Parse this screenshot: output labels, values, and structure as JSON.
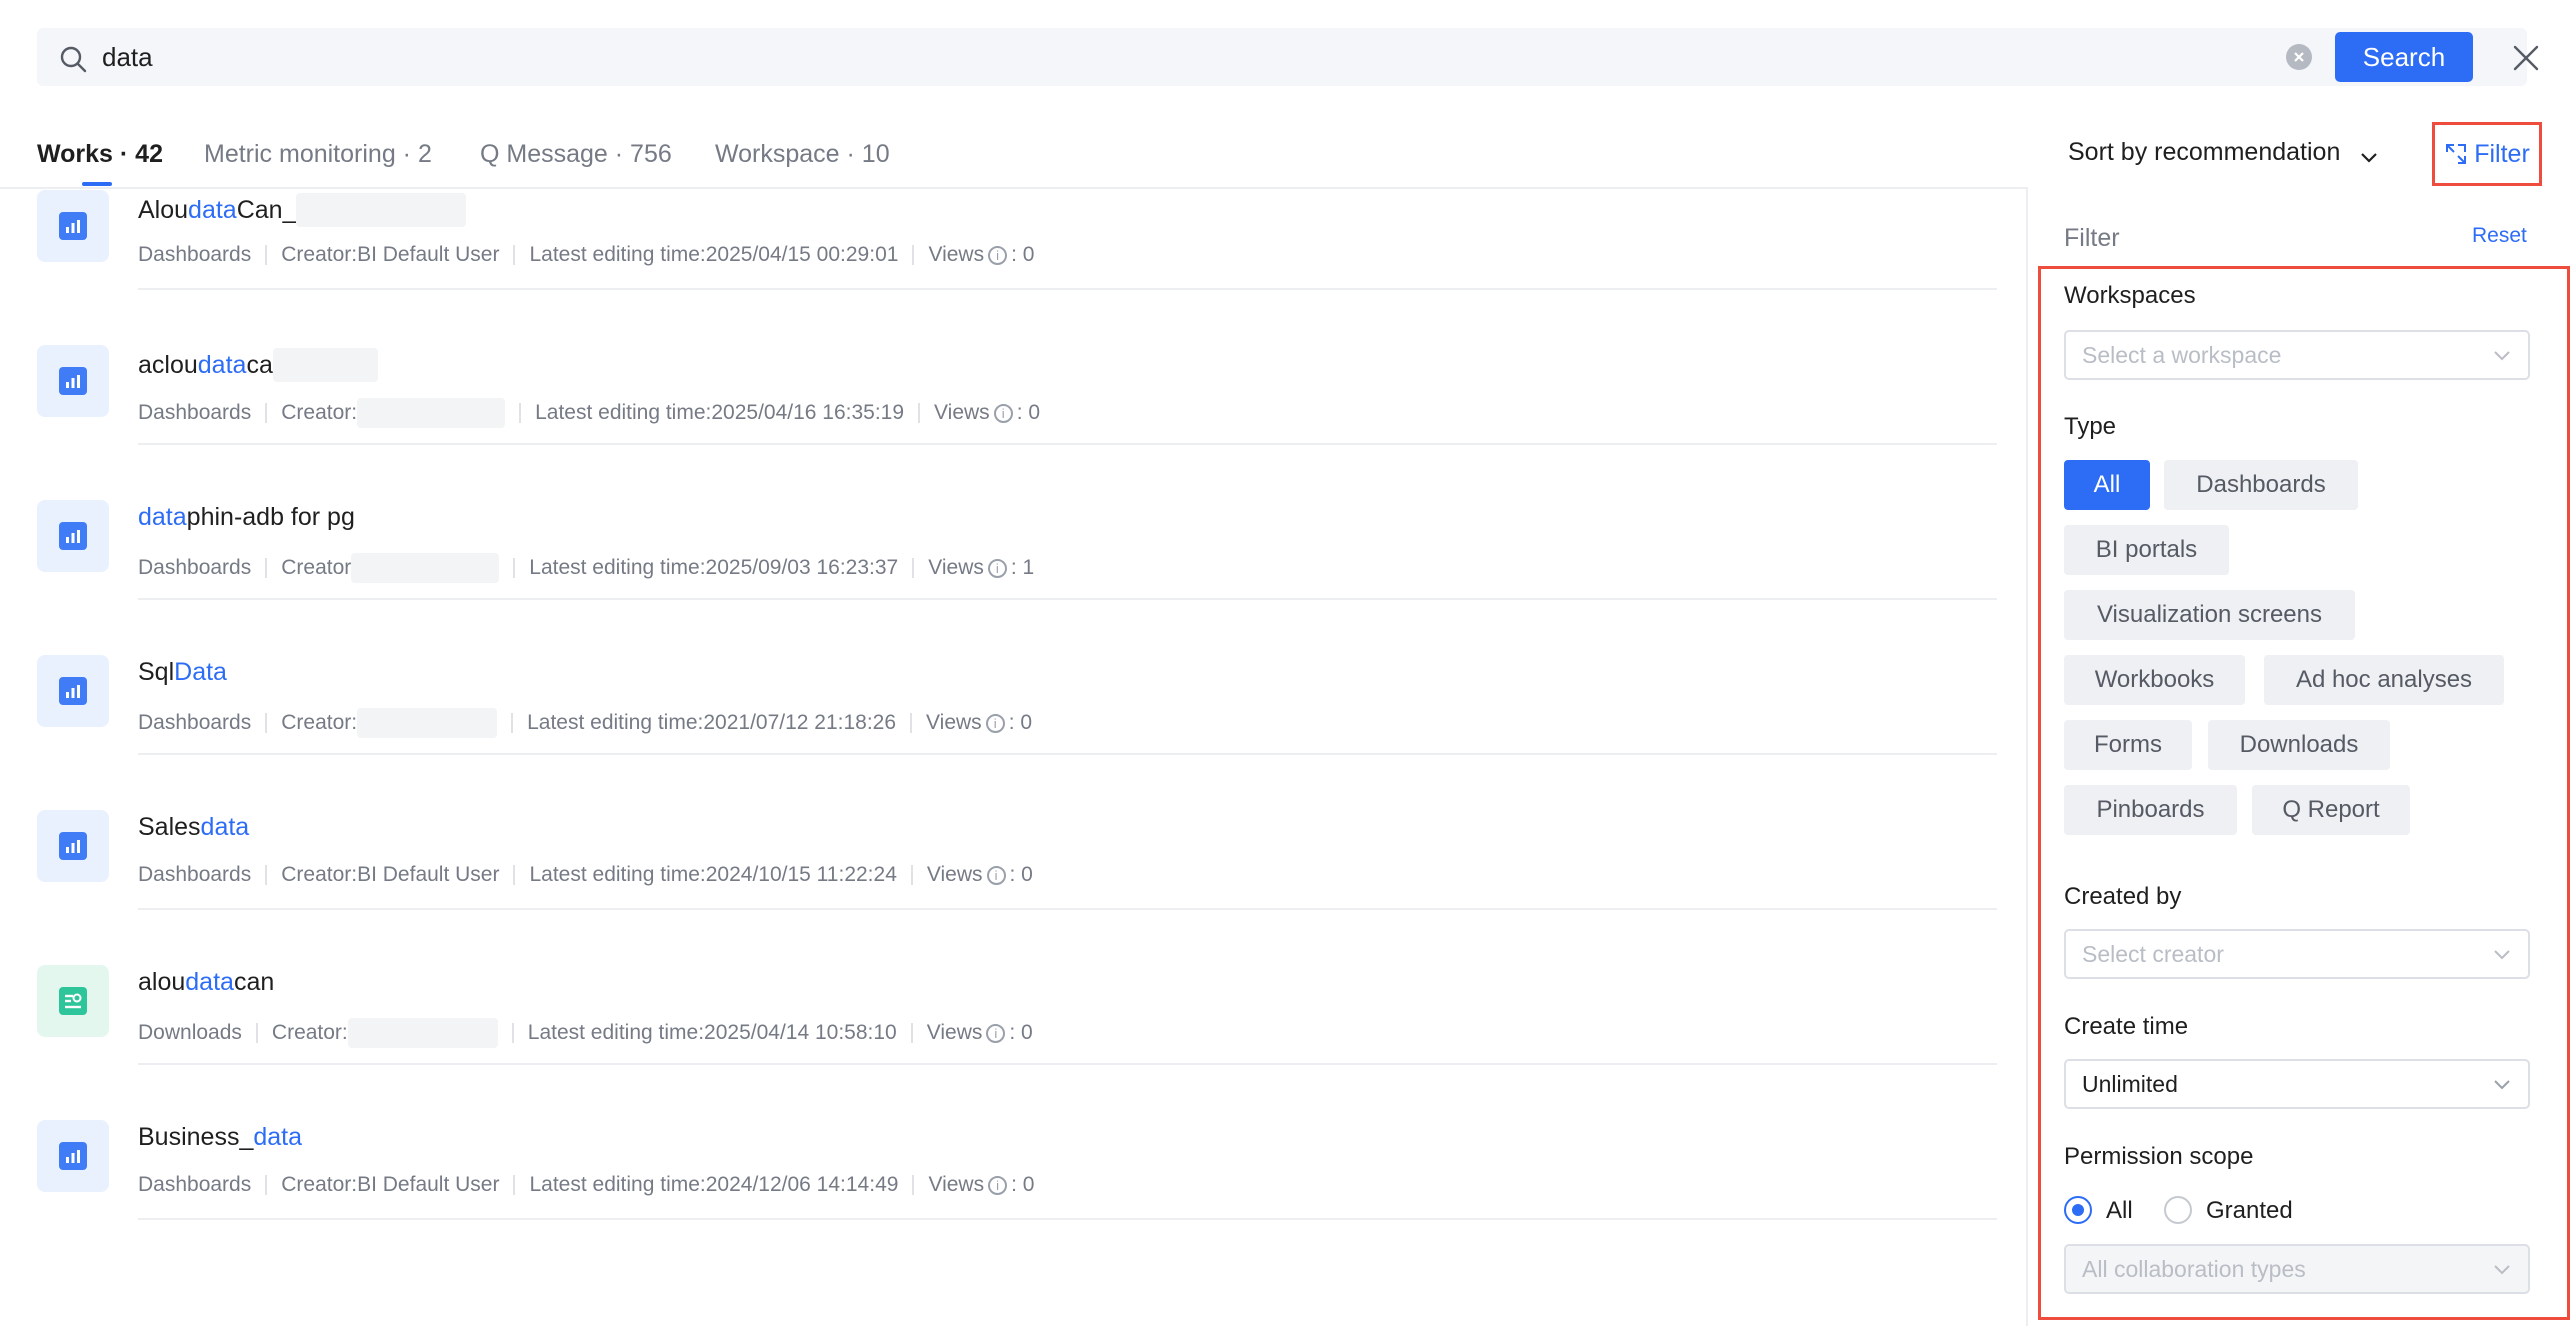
{
  "search": {
    "query": "data",
    "button_label": "Search"
  },
  "tabs": [
    {
      "label": "Works · 42"
    },
    {
      "label": "Metric monitoring · 2"
    },
    {
      "label": "Q Message · 756"
    },
    {
      "label": "Workspace · 10"
    }
  ],
  "sort": {
    "label": "Sort by recommendation"
  },
  "filter_button": {
    "label": "Filter"
  },
  "results": [
    {
      "title_pre": "Alou",
      "title_hl": "data",
      "title_post": "Can_",
      "type": "Dashboards",
      "creator": "Creator:BI Default User",
      "edit_time": "Latest editing time:2025/04/15 00:29:01",
      "views_label": "Views",
      "views": ": 0",
      "icon": "dashboard-icon"
    },
    {
      "title_pre": "aclou",
      "title_hl": "data",
      "title_post": "ca",
      "type": "Dashboards",
      "creator": "Creator:",
      "edit_time": "Latest editing time:2025/04/16 16:35:19",
      "views_label": "Views",
      "views": ": 0",
      "icon": "dashboard-icon"
    },
    {
      "title_pre": "",
      "title_hl": "data",
      "title_post": "phin-adb for pg",
      "type": "Dashboards",
      "creator": "Creator",
      "edit_time": "Latest editing time:2025/09/03 16:23:37",
      "views_label": "Views",
      "views": ": 1",
      "icon": "dashboard-icon"
    },
    {
      "title_pre": "Sql",
      "title_hl": "Data",
      "title_post": "",
      "type": "Dashboards",
      "creator": "Creator:",
      "edit_time": "Latest editing time:2021/07/12 21:18:26",
      "views_label": "Views",
      "views": ": 0",
      "icon": "dashboard-icon"
    },
    {
      "title_pre": "Sales ",
      "title_hl": "data",
      "title_post": "",
      "type": "Dashboards",
      "creator": "Creator:BI Default User",
      "edit_time": "Latest editing time:2024/10/15 11:22:24",
      "views_label": "Views",
      "views": ": 0",
      "icon": "dashboard-icon"
    },
    {
      "title_pre": "alou",
      "title_hl": "data",
      "title_post": "can",
      "type": "Downloads",
      "creator": "Creator:",
      "edit_time": "Latest editing time:2025/04/14 10:58:10",
      "views_label": "Views",
      "views": ": 0",
      "icon": "download-icon"
    },
    {
      "title_pre": "Business_",
      "title_hl": "data",
      "title_post": "",
      "type": "Dashboards",
      "creator": "Creator:BI Default User",
      "edit_time": "Latest editing time:2024/12/06 14:14:49",
      "views_label": "Views",
      "views": ": 0",
      "icon": "dashboard-icon"
    }
  ],
  "filter_panel": {
    "title": "Filter",
    "reset_label": "Reset",
    "workspaces": {
      "label": "Workspaces",
      "placeholder": "Select a workspace"
    },
    "type": {
      "label": "Type",
      "options": [
        "All",
        "Dashboards",
        "BI portals",
        "Visualization screens",
        "Workbooks",
        "Ad hoc analyses",
        "Forms",
        "Downloads",
        "Pinboards",
        "Q Report"
      ],
      "selected": "All"
    },
    "created_by": {
      "label": "Created by",
      "placeholder": "Select creator"
    },
    "create_time": {
      "label": "Create time",
      "value": "Unlimited"
    },
    "permission_scope": {
      "label": "Permission scope",
      "options": [
        "All",
        "Granted"
      ],
      "selected": "All",
      "collab_placeholder": "All collaboration types"
    }
  },
  "colors": {
    "accent": "#2d6df6",
    "highlight_border": "#ee4d3e"
  }
}
